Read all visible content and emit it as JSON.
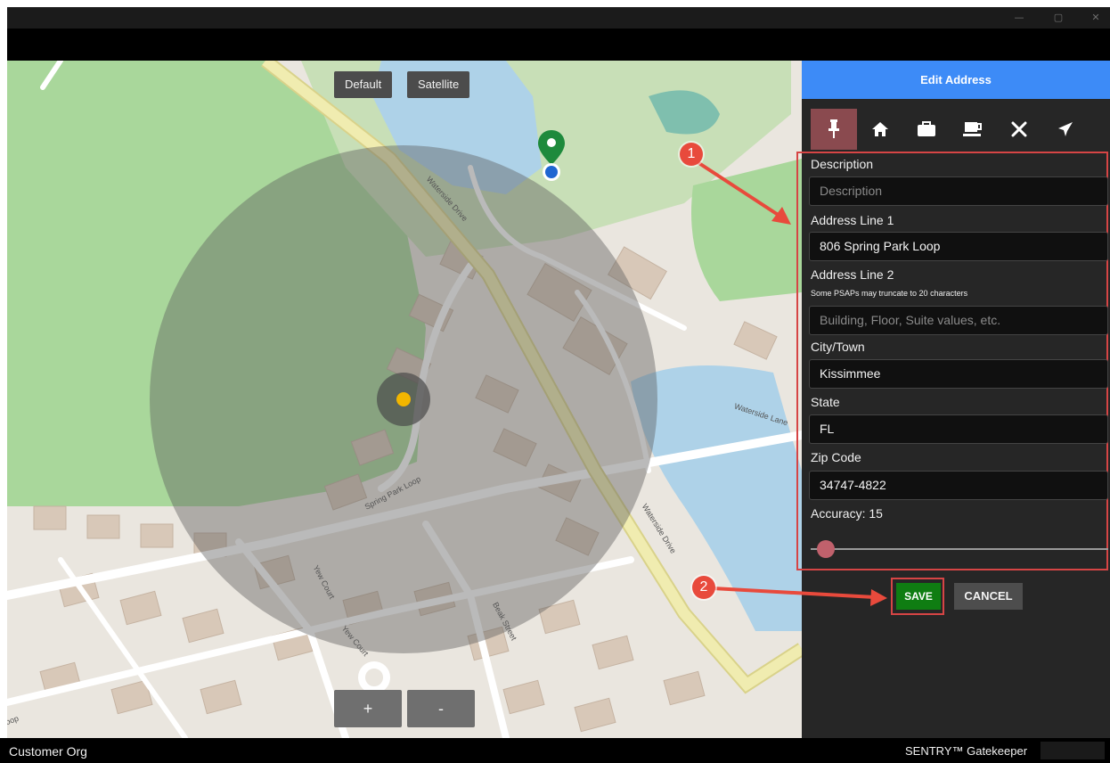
{
  "window": {
    "controls": [
      "—",
      "▢",
      "✕"
    ]
  },
  "map": {
    "toggle_default": "Default",
    "toggle_satellite": "Satellite",
    "zoom_in": "+",
    "zoom_out": "-",
    "street_labels": [
      "Waterside Drive",
      "Waterside Drive",
      "Waterside Lane",
      "Spring Park Loop",
      "Yew Court",
      "Yew Court",
      "Beak Street",
      "oop"
    ],
    "colors": {
      "accuracy_circle": "#5a5a5a",
      "pin_green": "#1e8a3c",
      "marker_blue": "#1f66d1",
      "marker_yellow": "#f2b600"
    }
  },
  "panel": {
    "title": "Edit Address",
    "tabs": [
      {
        "icon": "pin-icon",
        "active": true
      },
      {
        "icon": "home-icon",
        "active": false
      },
      {
        "icon": "briefcase-icon",
        "active": false
      },
      {
        "icon": "coffee-icon",
        "active": false
      },
      {
        "icon": "utensils-icon",
        "active": false
      },
      {
        "icon": "airplane-icon",
        "active": false
      }
    ],
    "fields": {
      "description_label": "Description",
      "description_placeholder": "Description",
      "address1_label": "Address Line 1",
      "address1_value": "806 Spring Park Loop",
      "address2_label": "Address Line 2",
      "address2_hint": "Some PSAPs may truncate to 20 characters",
      "address2_placeholder": "Building, Floor, Suite values, etc.",
      "city_label": "City/Town",
      "city_value": "Kissimmee",
      "state_label": "State",
      "state_value": "FL",
      "zip_label": "Zip Code",
      "zip_value": "34747-4822",
      "accuracy_label": "Accuracy: 15"
    },
    "accuracy_level": 0.03,
    "save": "SAVE",
    "cancel": "CANCEL",
    "colors": {
      "header": "#3d8bf7",
      "active_tab": "#8a4a4f",
      "save": "#0f7d12",
      "annotation": "#e84a3c"
    }
  },
  "annotations": {
    "badge1": "1",
    "badge2": "2"
  },
  "status": {
    "left": "Customer Org",
    "right": "SENTRY™ Gatekeeper"
  }
}
